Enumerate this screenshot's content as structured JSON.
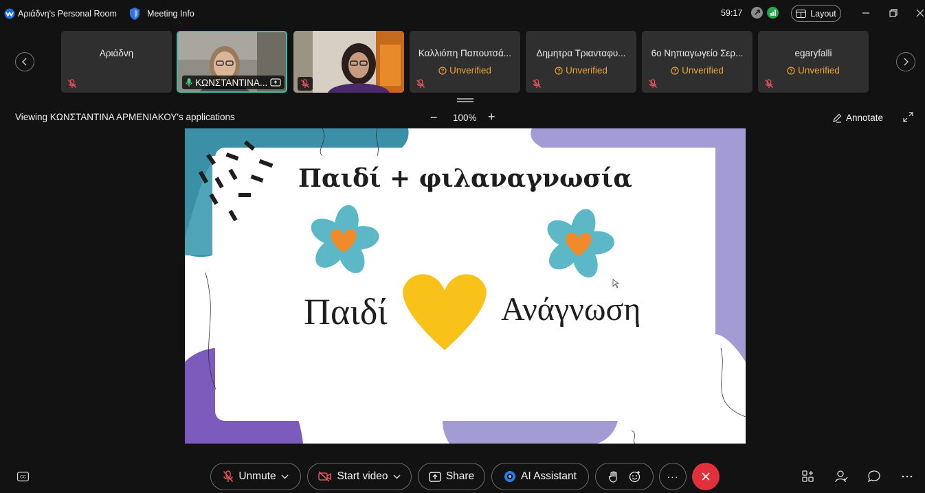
{
  "titlebar": {
    "room_title": "Αριάδνη's Personal Room",
    "meeting_info": "Meeting Info",
    "timer": "59:17",
    "layout_label": "Layout"
  },
  "participants": [
    {
      "name": "Αριάδνη",
      "status": "",
      "muted": true
    },
    {
      "name": "ΚΩΝΣΤΑΝΤΙΝΑ...",
      "status": "",
      "muted": false,
      "active_speaker": true
    },
    {
      "name": "",
      "status": "",
      "muted": true
    },
    {
      "name": "Καλλιόπη Παπουτσά...",
      "status": "Unverified",
      "muted": true
    },
    {
      "name": "Δημητρα Τριανταφυ...",
      "status": "Unverified",
      "muted": true
    },
    {
      "name": "6ο Νηπιαγωγείο Σερ...",
      "status": "Unverified",
      "muted": true
    },
    {
      "name": "egaryfalli",
      "status": "Unverified",
      "muted": true
    }
  ],
  "share": {
    "viewing_text": "Viewing ΚΩΝΣΤΑΝΤΙΝΑ ΑΡΜΕΝΙΑΚΟΥ's applications",
    "zoom_minus": "−",
    "zoom_level": "100%",
    "zoom_plus": "+",
    "annotate_label": "Annotate"
  },
  "slide": {
    "title": "Παιδί + φιλαναγνωσία",
    "word_left": "Παιδί",
    "word_right": "Ανάγνωση"
  },
  "controls": {
    "unmute_label": "Unmute",
    "start_video_label": "Start video",
    "share_label": "Share",
    "ai_assistant_label": "AI Assistant",
    "more_label": "···"
  },
  "colors": {
    "active_border": "#38c0a8",
    "unverified": "#e7a23a",
    "end_call": "#e0303a",
    "mic_muted": "#e8525a",
    "slide_teal": "#3b8fa6",
    "slide_purple": "#7c5bbd",
    "slide_lavender": "#a39bd4",
    "heart_yellow": "#f8c21a",
    "heart_orange": "#f08a2a",
    "flower_teal": "#5cb8c6"
  },
  "icons": [
    "webex-logo-icon",
    "shield-icon",
    "share-status-icon",
    "signal-icon",
    "layout-icon",
    "minimize-icon",
    "restore-icon",
    "close-icon",
    "chevron-left-icon",
    "chevron-right-icon",
    "mic-off-icon",
    "mic-on-icon",
    "screen-share-icon",
    "warning-circle-icon",
    "annotate-pen-icon",
    "expand-icon",
    "captions-icon",
    "video-off-icon",
    "share-icon",
    "ai-assistant-icon",
    "raise-hand-icon",
    "reaction-icon",
    "end-call-icon",
    "apps-icon",
    "participants-icon",
    "chat-icon",
    "more-icon"
  ]
}
